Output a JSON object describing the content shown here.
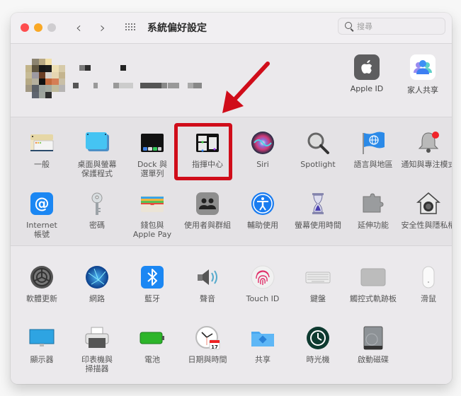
{
  "window": {
    "title": "系統偏好設定",
    "traffic_lights": [
      "close",
      "minimize",
      "zoom"
    ],
    "nav": {
      "back_icon": "chevron-left-icon",
      "forward_icon": "chevron-right-icon",
      "grid_icon": "show-all-grid-icon",
      "back_glyph": "‹",
      "forward_glyph": "›"
    },
    "search": {
      "placeholder": "搜尋",
      "value": ""
    }
  },
  "account": {
    "name_redacted": true,
    "items": [
      {
        "id": "apple-id",
        "label": "Apple ID",
        "icon": "apple-logo-icon"
      },
      {
        "id": "family-sharing",
        "label": "家人共享",
        "icon": "family-people-icon"
      }
    ]
  },
  "section1": {
    "rows": [
      [
        {
          "id": "general",
          "label": "一般",
          "icon": "general-window-icon"
        },
        {
          "id": "desktop-screensaver",
          "label": "桌面與螢幕\n保護程式",
          "icon": "desktop-icon"
        },
        {
          "id": "dock-menubar",
          "label": "Dock 與\n選單列",
          "icon": "dock-icon"
        },
        {
          "id": "mission-control",
          "label": "指揮中心",
          "icon": "mission-control-icon",
          "highlighted": true
        },
        {
          "id": "siri",
          "label": "Siri",
          "icon": "siri-orb-icon"
        },
        {
          "id": "spotlight",
          "label": "Spotlight",
          "icon": "magnifier-icon"
        },
        {
          "id": "language-region",
          "label": "語言與地區",
          "icon": "globe-flag-icon"
        },
        {
          "id": "notifications-focus",
          "label": "通知與專注模式",
          "icon": "bell-icon"
        }
      ],
      [
        {
          "id": "internet-accounts",
          "label": "Internet\n帳號",
          "icon": "at-sign-icon"
        },
        {
          "id": "passwords",
          "label": "密碼",
          "icon": "key-icon"
        },
        {
          "id": "wallet-applepay",
          "label": "錢包與\nApple Pay",
          "icon": "wallet-icon"
        },
        {
          "id": "users-groups",
          "label": "使用者與群組",
          "icon": "users-icon"
        },
        {
          "id": "accessibility",
          "label": "輔助使用",
          "icon": "accessibility-icon"
        },
        {
          "id": "screen-time",
          "label": "螢幕使用時間",
          "icon": "hourglass-icon"
        },
        {
          "id": "extensions",
          "label": "延伸功能",
          "icon": "puzzle-icon"
        },
        {
          "id": "security-privacy",
          "label": "安全性與隱私權",
          "icon": "house-lock-icon"
        }
      ]
    ]
  },
  "section2": {
    "rows": [
      [
        {
          "id": "software-update",
          "label": "軟體更新",
          "icon": "gear-icon"
        },
        {
          "id": "network",
          "label": "網路",
          "icon": "network-globe-icon"
        },
        {
          "id": "bluetooth",
          "label": "藍牙",
          "icon": "bluetooth-icon"
        },
        {
          "id": "sound",
          "label": "聲音",
          "icon": "speaker-icon"
        },
        {
          "id": "touch-id",
          "label": "Touch ID",
          "icon": "fingerprint-icon"
        },
        {
          "id": "keyboard",
          "label": "鍵盤",
          "icon": "keyboard-icon"
        },
        {
          "id": "trackpad",
          "label": "觸控式軌跡板",
          "icon": "trackpad-icon"
        },
        {
          "id": "mouse",
          "label": "滑鼠",
          "icon": "mouse-icon"
        }
      ],
      [
        {
          "id": "displays",
          "label": "顯示器",
          "icon": "display-icon"
        },
        {
          "id": "printers-scanners",
          "label": "印表機與\n掃描器",
          "icon": "printer-icon"
        },
        {
          "id": "battery",
          "label": "電池",
          "icon": "battery-icon"
        },
        {
          "id": "date-time",
          "label": "日期與時間",
          "icon": "clock-calendar-icon",
          "calendar_day": "17"
        },
        {
          "id": "sharing",
          "label": "共享",
          "icon": "folder-share-icon"
        },
        {
          "id": "time-machine",
          "label": "時光機",
          "icon": "time-machine-icon"
        },
        {
          "id": "startup-disk",
          "label": "啟動磁碟",
          "icon": "hard-disk-icon"
        }
      ]
    ]
  },
  "annotation": {
    "highlight_target": "mission-control",
    "highlight_color": "#d00d1a",
    "arrow_color": "#d00d1a"
  }
}
